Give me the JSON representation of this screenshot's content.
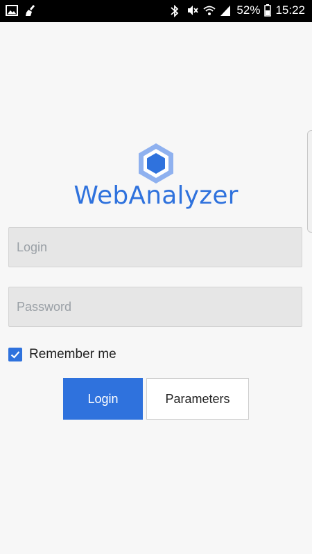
{
  "status_bar": {
    "battery": "52%",
    "time": "15:22",
    "left_icons": [
      "image-icon",
      "cleaner-icon"
    ],
    "right_icons": [
      "bluetooth-icon",
      "mute-icon",
      "wifi-icon",
      "signal-icon",
      "battery-icon"
    ]
  },
  "app": {
    "name": "WebAnalyzer",
    "accent_color": "#2f72dd",
    "logo_icon": "hexagon-logo-icon"
  },
  "form": {
    "login_placeholder": "Login",
    "password_placeholder": "Password",
    "remember_label": "Remember me",
    "remember_checked": true
  },
  "buttons": {
    "login": "Login",
    "parameters": "Parameters"
  }
}
